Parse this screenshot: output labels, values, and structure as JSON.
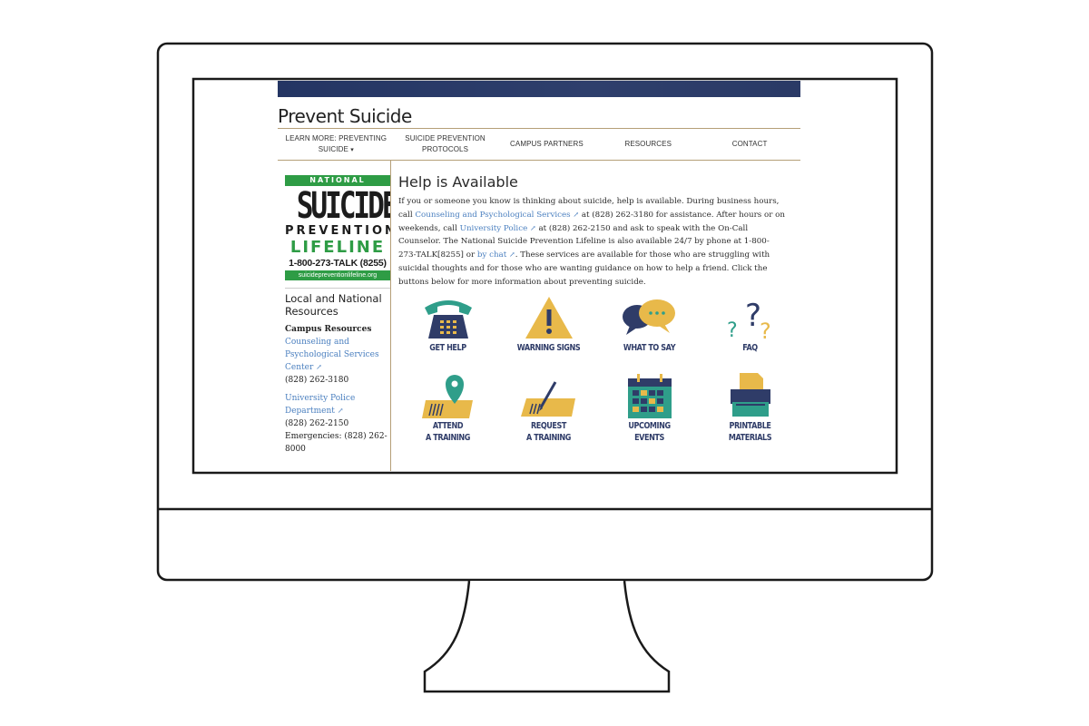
{
  "site": {
    "title": "Prevent Suicide",
    "nav": [
      {
        "label": "LEARN MORE: PREVENTING SUICIDE",
        "caret": "▾"
      },
      {
        "label": "SUICIDE PREVENTION PROTOCOLS"
      },
      {
        "label": "CAMPUS PARTNERS"
      },
      {
        "label": "RESOURCES"
      },
      {
        "label": "CONTACT"
      }
    ]
  },
  "logo": {
    "national": "NATIONAL",
    "suicide": "SUICIDE",
    "prevention": "PREVENTION",
    "lifeline": "LIFELINE",
    "phone": "1-800-273-TALK (8255)",
    "url": "suicidepreventionlifeline.org"
  },
  "sidebar": {
    "heading": "Local and National Resources",
    "subheading": "Campus Resources",
    "counseling_link": "Counseling and Psychological Services Center",
    "counseling_phone": "(828) 262-3180",
    "police_link": "University Police Department",
    "police_phone": "(828) 262-2150",
    "emergencies": "Emergencies: (828) 262-8000"
  },
  "main": {
    "title": "Help is Available",
    "p1": "If you or someone you know is thinking about suicide, help is available. During business hours, call ",
    "link1": "Counseling and Psychological Services",
    "p2": " at (828) 262-3180 for assistance. After hours or on weekends, call ",
    "link2": "University Police",
    "p3": " at (828) 262-2150 and ask to speak with the On-Call Counselor. The National Suicide Prevention Lifeline is also available 24/7 by phone at 1-800-273-TALK[8255] or ",
    "link3": "by chat",
    "p4": ". These services are available for those who are struggling with suicidal thoughts and for those who are wanting guidance on how to help a friend. Click the buttons below for more information about preventing suicide."
  },
  "tiles": [
    {
      "label": "GET HELP",
      "icon": "telephone-icon"
    },
    {
      "label": "WARNING SIGNS",
      "icon": "warning-icon"
    },
    {
      "label": "WHAT TO SAY",
      "icon": "speech-bubbles-icon"
    },
    {
      "label": "FAQ",
      "icon": "question-marks-icon"
    },
    {
      "label": "ATTEND\nA TRAINING",
      "icon": "map-pin-icon"
    },
    {
      "label": "REQUEST\nA TRAINING",
      "icon": "pen-paper-icon"
    },
    {
      "label": "UPCOMING\nEVENTS",
      "icon": "calendar-icon"
    },
    {
      "label": "PRINTABLE\nMATERIALS",
      "icon": "printer-icon"
    }
  ],
  "colors": {
    "navy": "#2f3c68",
    "gold": "#e8b94a",
    "teal": "#2f9e8a",
    "green": "#2e9c45",
    "link": "#4a7fbf",
    "rule": "#b59f78"
  }
}
